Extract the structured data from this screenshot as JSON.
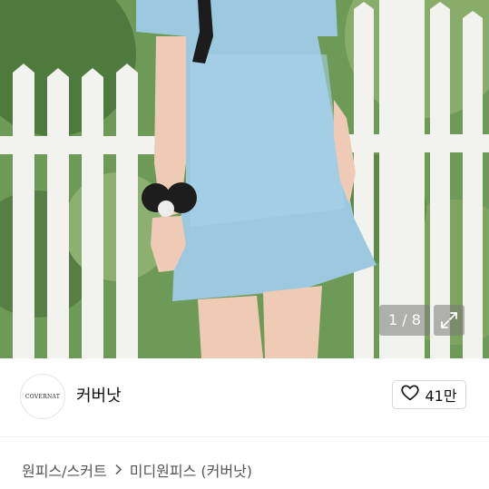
{
  "product_image": {
    "description_icon": "product-photo",
    "counter": "1 / 8",
    "expand_icon": "expand-icon"
  },
  "shop": {
    "logo_text": "COVERNAT",
    "name": "커버낫",
    "like_count": "41만",
    "like_icon": "heart-icon"
  },
  "breadcrumb": {
    "category": "원피스/스커트",
    "separator": ">",
    "current": "미디원피스 (커버낫)"
  },
  "colors": {
    "accent_text": "#111111",
    "muted_text": "#555555"
  }
}
